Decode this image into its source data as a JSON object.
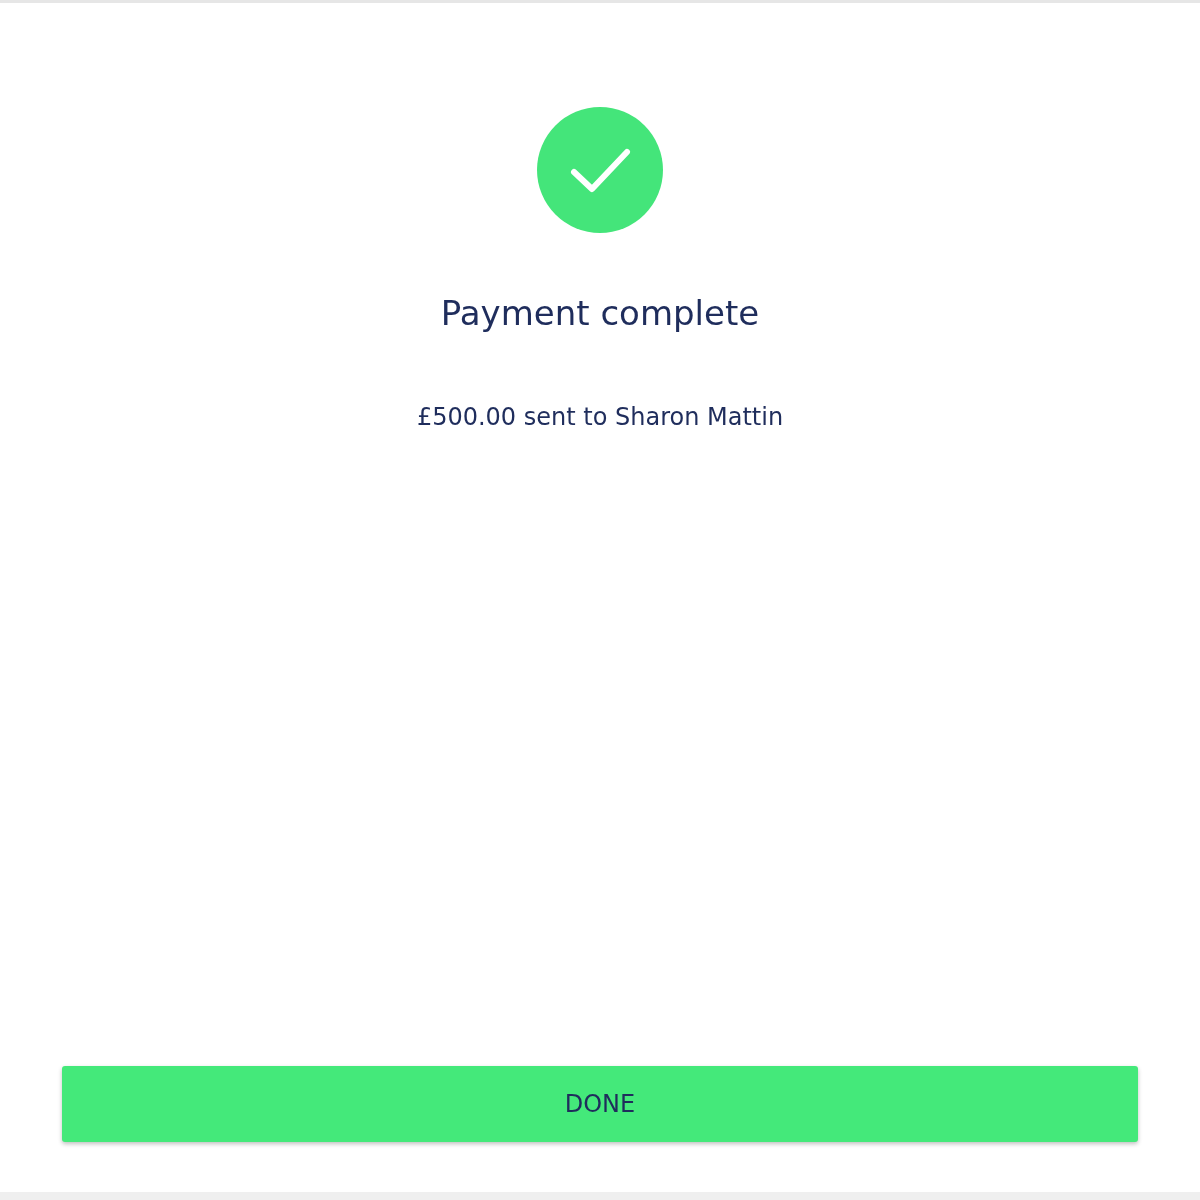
{
  "status": {
    "kind": "success"
  },
  "title": "Payment complete",
  "message": "£500.00 sent to Sharon Mattin",
  "button": {
    "label": "DONE"
  }
}
